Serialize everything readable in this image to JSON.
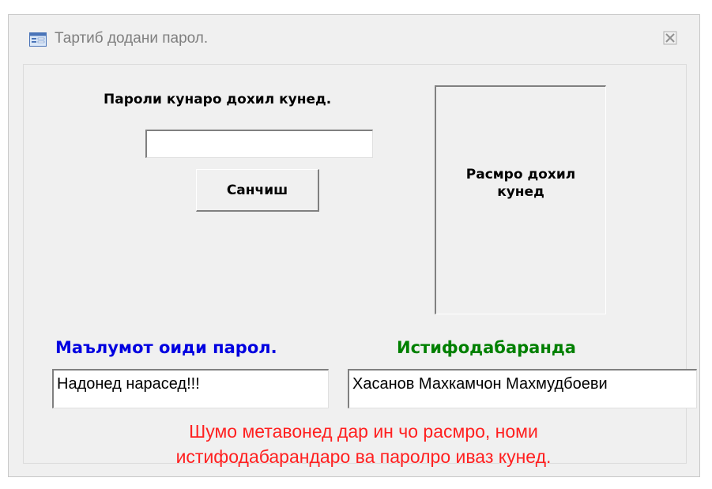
{
  "window": {
    "title": "Тартиб додани парол.",
    "icon": "form-icon",
    "close_icon": "close-icon"
  },
  "password": {
    "label": "Пароли кунаро дохил кунед.",
    "value": "",
    "check_button": "Санчиш"
  },
  "photo": {
    "label": "Расмро дохил кунед"
  },
  "info": {
    "label": "Маълумот оиди парол.",
    "value": "Надонед нарасед!!!",
    "color": "#0000e0"
  },
  "user": {
    "label": "Истифодабаранда",
    "value": "Хасанов Махкамчон Махмудбоеви",
    "color": "#008000"
  },
  "notice": {
    "line1": "Шумо метавонед дар ин чо расмро, номи",
    "line2": "истифодабарандаро ва паролро иваз кунед.",
    "color": "#ff2020"
  }
}
